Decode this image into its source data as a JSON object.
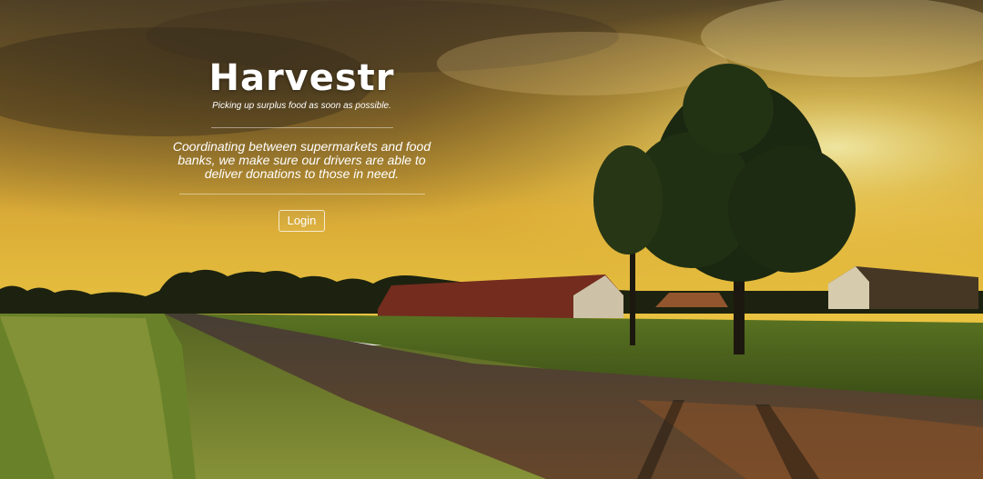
{
  "hero": {
    "title": "Harvestr",
    "tagline": "Picking up surplus food as soon as possible.",
    "description": "Coordinating between supermarkets and food banks, we make sure our drivers are able to deliver donations to those in need.",
    "login_label": "Login"
  }
}
